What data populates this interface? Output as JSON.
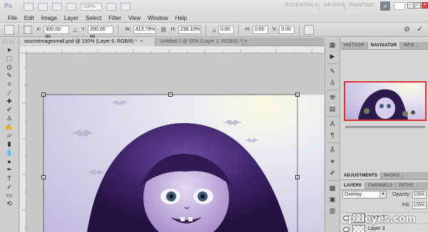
{
  "app": {
    "logo": "Ps",
    "zoom": "100%",
    "workspaces": [
      "ESSENTIALS",
      "DESIGN",
      "PAINTING"
    ],
    "more_label": "»"
  },
  "menu": [
    "File",
    "Edit",
    "Image",
    "Layer",
    "Select",
    "Filter",
    "View",
    "Window",
    "Help"
  ],
  "options": {
    "x_label": "X:",
    "x_value": "300.00 px",
    "y_label": "Y:",
    "y_value": "200.00 px",
    "w_label": "W:",
    "w_value": "413.79%",
    "h_label": "H:",
    "h_value": "238.10%",
    "angle_value": "0.00",
    "hskew_label": "H:",
    "hskew_value": "0.00",
    "vskew_label": "V:",
    "vskew_value": "0.00",
    "cancel_symbol": "⊘",
    "commit_symbol": "✓"
  },
  "tabs": [
    {
      "label": "sourceimagesmall.psd @ 100% (Layer 6, RGB/8) *",
      "close": "×"
    },
    {
      "label": "Untitled-1 @ 50% (Layer 1, RGB/8) *",
      "close": "×"
    }
  ],
  "panels": {
    "top_tabs": [
      "HISTOGR",
      "NAVIGATOR",
      "INFO"
    ],
    "adjust_tabs": [
      "ADJUSTMENTS",
      "MASKS"
    ],
    "layer_tabs": [
      "LAYERS",
      "CHANNELS",
      "PATHS"
    ],
    "blend_mode": "Overlay",
    "opacity_label": "Opacity:",
    "opacity_value": "100%",
    "fill_label": "Fill:",
    "fill_value": "100%",
    "layers": [
      "Layer 7",
      "Layer 3"
    ]
  },
  "watermark": "pxleyes.com",
  "colors": {
    "accent_red": "#d33333",
    "art_purple": "#5a2f86"
  }
}
